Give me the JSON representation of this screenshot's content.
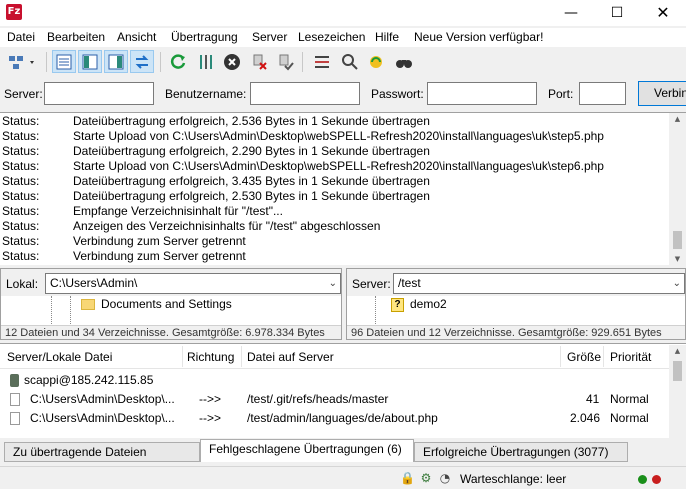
{
  "window": {
    "app_icon_text": "Fz",
    "min_glyph": "—",
    "max_glyph": "☐",
    "close_glyph": "✕"
  },
  "menu": [
    "Datei",
    "Bearbeiten",
    "Ansicht",
    "Übertragung",
    "Server",
    "Lesezeichen",
    "Hilfe",
    "Neue Version verfügbar!"
  ],
  "quickconnect": {
    "server_label": "Server:",
    "user_label": "Benutzername:",
    "password_label": "Passwort:",
    "port_label": "Port:",
    "connect_button": "Verbinden",
    "server_value": "",
    "user_value": "",
    "password_value": "",
    "port_value": ""
  },
  "log": [
    {
      "label": "Status:",
      "message": "Dateiübertragung erfolgreich, 2.536 Bytes in 1 Sekunde übertragen"
    },
    {
      "label": "Status:",
      "message": "Starte Upload von C:\\Users\\Admin\\Desktop\\webSPELL-Refresh2020\\install\\languages\\uk\\step5.php"
    },
    {
      "label": "Status:",
      "message": "Dateiübertragung erfolgreich, 2.290 Bytes in 1 Sekunde übertragen"
    },
    {
      "label": "Status:",
      "message": "Starte Upload von C:\\Users\\Admin\\Desktop\\webSPELL-Refresh2020\\install\\languages\\uk\\step6.php"
    },
    {
      "label": "Status:",
      "message": "Dateiübertragung erfolgreich, 3.435 Bytes in 1 Sekunde übertragen"
    },
    {
      "label": "Status:",
      "message": "Dateiübertragung erfolgreich, 2.530 Bytes in 1 Sekunde übertragen"
    },
    {
      "label": "Status:",
      "message": "Empfange Verzeichnisinhalt für \"/test\"..."
    },
    {
      "label": "Status:",
      "message": "Anzeigen des Verzeichnisinhalts für \"/test\" abgeschlossen"
    },
    {
      "label": "Status:",
      "message": "Verbindung zum Server getrennt"
    },
    {
      "label": "Status:",
      "message": "Verbindung zum Server getrennt"
    }
  ],
  "local": {
    "label": "Lokal:",
    "path": "C:\\Users\\Admin\\",
    "tree": [
      "Documents and Settings"
    ],
    "summary": "12 Dateien und 34 Verzeichnisse. Gesamtgröße: 6.978.334 Bytes"
  },
  "remote": {
    "label": "Server:",
    "path": "/test",
    "tree": [
      "demo2"
    ],
    "summary": "96 Dateien und 12 Verzeichnisse. Gesamtgröße: 929.651 Bytes"
  },
  "queue": {
    "columns": [
      "Server/Lokale Datei",
      "Richtung",
      "Datei auf Server",
      "Größe",
      "Priorität"
    ],
    "server_entry": "scappi@185.242.115.85",
    "rows": [
      {
        "local": "C:\\Users\\Admin\\Desktop\\...",
        "direction": "-->>",
        "remote": "/test/.git/refs/heads/master",
        "size": "41",
        "priority": "Normal"
      },
      {
        "local": "C:\\Users\\Admin\\Desktop\\...",
        "direction": "-->>",
        "remote": "/test/admin/languages/de/about.php",
        "size": "2.046",
        "priority": "Normal"
      }
    ]
  },
  "tabs": [
    {
      "label": "Zu übertragende Dateien",
      "active": false
    },
    {
      "label": "Fehlgeschlagene Übertragungen (6)",
      "active": true
    },
    {
      "label": "Erfolgreiche Übertragungen (3077)",
      "active": false
    }
  ],
  "statusbar": {
    "queue_text": "Warteschlange: leer",
    "led_colors": [
      "#1a8f1a",
      "#c81e1e"
    ]
  },
  "colors": {
    "accent": "#0078d7",
    "pressed": "#cce4f7"
  }
}
